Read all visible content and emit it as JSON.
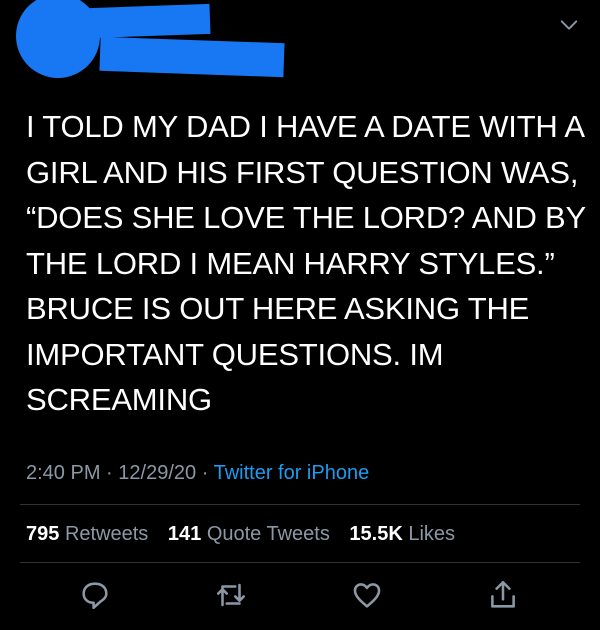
{
  "colors": {
    "background": "#000000",
    "text": "#ffffff",
    "muted": "#8b98a5",
    "link": "#1d9bf0",
    "redaction": "#1877f2"
  },
  "tweet": {
    "text": "I TOLD MY DAD I HAVE A DATE WITH A\nGIRL AND HIS FIRST QUESTION WAS,\n“DOES SHE LOVE THE LORD? AND BY\nTHE LORD I MEAN HARRY STYLES.”\nBRUCE IS OUT HERE ASKING THE\nIMPORTANT QUESTIONS. IM\nSCREAMING",
    "time": "2:40 PM",
    "sep1": "·",
    "date": "12/29/20",
    "sep2": "·",
    "source": "Twitter for iPhone"
  },
  "stats": {
    "retweets_count": "795",
    "retweets_label": "Retweets",
    "quotes_count": "141",
    "quotes_label": "Quote Tweets",
    "likes_count": "15.5K",
    "likes_label": "Likes"
  },
  "icons": {
    "more": "chevron-down-icon",
    "reply": "reply-icon",
    "retweet": "retweet-icon",
    "like": "heart-icon",
    "share": "share-icon"
  }
}
